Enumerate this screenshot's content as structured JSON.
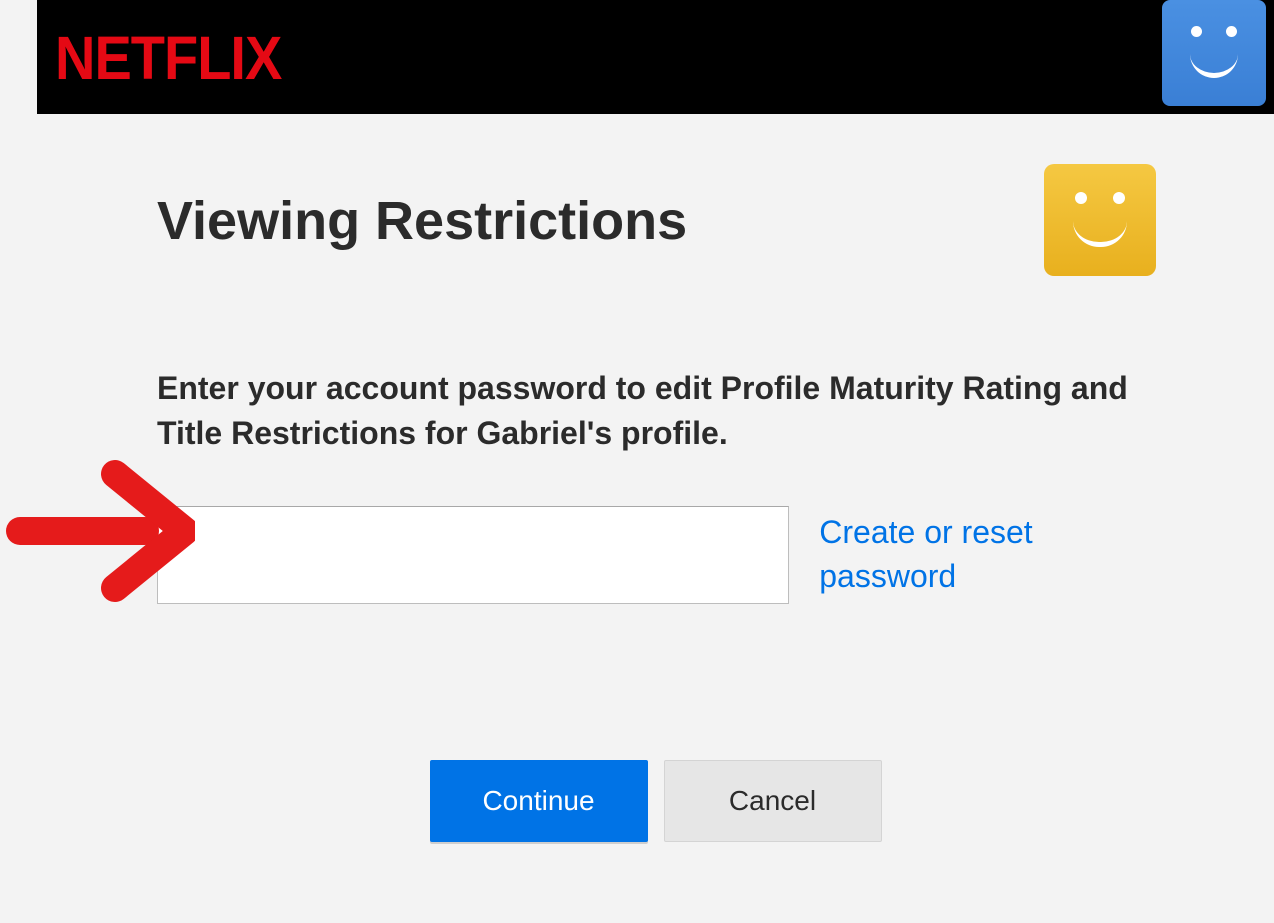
{
  "brand": "NETFLIX",
  "page": {
    "title": "Viewing Restrictions",
    "instruction": "Enter your account password to edit Profile Maturity Rating and Title Restrictions for Gabriel's profile."
  },
  "form": {
    "password_value": "",
    "reset_link_label": "Create or reset password"
  },
  "buttons": {
    "continue": "Continue",
    "cancel": "Cancel"
  }
}
